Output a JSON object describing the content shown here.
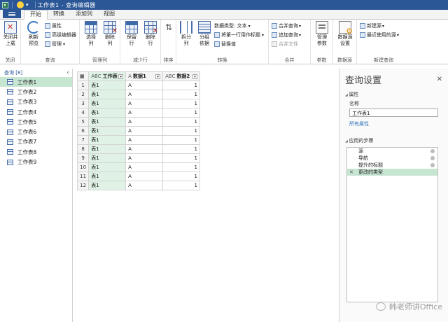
{
  "titlebar": {
    "doc_name": "工作表1 - 查询编辑器"
  },
  "tabs": [
    "开始",
    "转换",
    "添加列",
    "视图"
  ],
  "ribbon": {
    "close_load": "关闭并\n上载",
    "refresh": "刷新\n预览",
    "properties": "属性",
    "advanced_editor": "高级编辑器",
    "manage": "管理",
    "choose_columns": "选择\n列",
    "remove_columns": "删除\n列",
    "keep_rows": "保留\n行",
    "remove_rows": "删除\n行",
    "split_column": "拆分\n列",
    "group_by": "分组\n依据",
    "data_type": "数据类型: 文本",
    "first_row_header": "将第一行用作标题",
    "replace_values": "替换值",
    "merge_queries": "合并查询",
    "append_queries": "追加查询",
    "combine_files": "合并文件",
    "manage_params": "管理\n参数",
    "datasource_settings": "数据源\n设置",
    "new_source": "新建源",
    "recent_sources": "最近使用的源",
    "groups": {
      "close": "关闭",
      "query": "查询",
      "manage_cols": "管理列",
      "reduce_rows": "减少行",
      "sort": "排序",
      "transform": "转换",
      "combine": "合并",
      "params": "参数",
      "datasource": "数据源",
      "new_query": "新建查询"
    }
  },
  "query_pane": {
    "header": "查询 [8]",
    "items": [
      "工作表1",
      "工作表2",
      "工作表3",
      "工作表4",
      "工作表5",
      "工作表6",
      "工作表7",
      "工作表8",
      "工作表9"
    ]
  },
  "grid": {
    "columns": [
      {
        "type": "ABC",
        "name": "工作表"
      },
      {
        "type": "A",
        "name": "数据1"
      },
      {
        "type": "ABC",
        "name": "数据2"
      }
    ],
    "rows": [
      [
        "1",
        "表1",
        "A",
        "1"
      ],
      [
        "2",
        "表1",
        "A",
        "1"
      ],
      [
        "3",
        "表1",
        "A",
        "1"
      ],
      [
        "4",
        "表1",
        "A",
        "1"
      ],
      [
        "5",
        "表1",
        "A",
        "1"
      ],
      [
        "6",
        "表1",
        "A",
        "1"
      ],
      [
        "7",
        "表1",
        "A",
        "1"
      ],
      [
        "8",
        "表1",
        "A",
        "1"
      ],
      [
        "9",
        "表1",
        "A",
        "1"
      ],
      [
        "10",
        "表1",
        "A",
        "1"
      ],
      [
        "11",
        "表1",
        "A",
        "1"
      ],
      [
        "12",
        "表1",
        "A",
        "1"
      ]
    ]
  },
  "settings_pane": {
    "title": "查询设置",
    "properties_header": "属性",
    "name_label": "名称",
    "name_value": "工作表1",
    "all_props": "所有属性",
    "steps_header": "应用的步骤",
    "steps": [
      "源",
      "导航",
      "提升的标题",
      "更改的类型"
    ]
  },
  "watermark": "韩老师讲Office"
}
